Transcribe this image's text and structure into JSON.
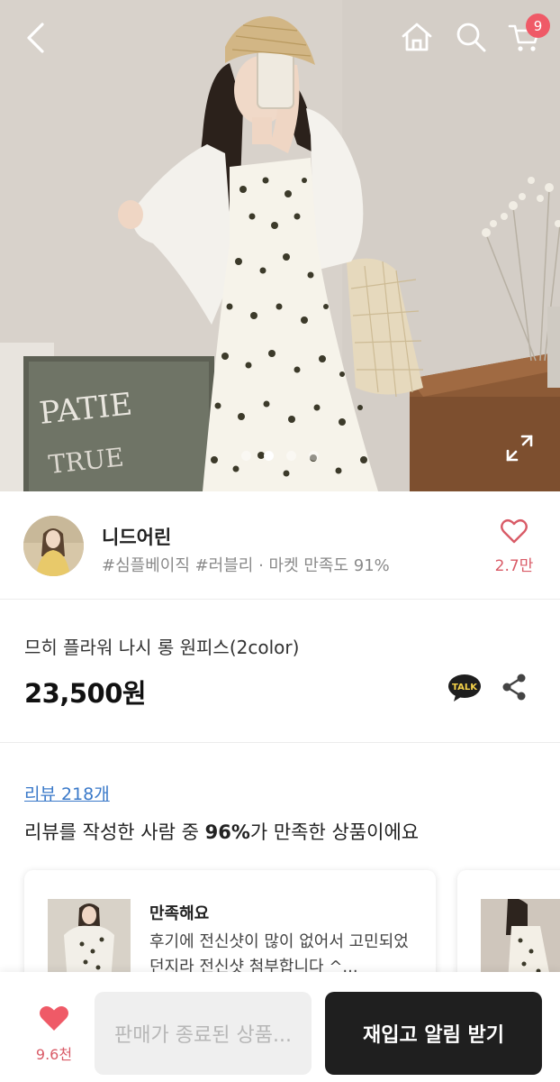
{
  "header": {
    "cart_count": "9"
  },
  "gallery": {
    "image_count": 4,
    "active_index": 1
  },
  "seller": {
    "name": "니드어린",
    "tags": "#심플베이직 #러블리 · 마켓 만족도 91%",
    "like_count": "2.7만"
  },
  "product": {
    "title": "므히 플라워 나시 롱 원피스(2color)",
    "price": "23,500원",
    "talk_label": "TALK"
  },
  "reviews": {
    "link": "리뷰 218개",
    "summary_prefix": "리뷰를 작성한 사람 중 ",
    "summary_highlight": "96%",
    "summary_suffix": "가 만족한 상품이에요",
    "items": [
      {
        "title": "만족해요",
        "text": "후기에 전신샷이 많이 없어서 고민되었던지라 전신샷  첨부합니다 ^..."
      }
    ]
  },
  "bottom_bar": {
    "wish_count": "9.6천",
    "soldout_label": "판매가 종료된 상품...",
    "notify_label": "재입고 알림 받기"
  },
  "colors": {
    "accent_pink": "#d95b67",
    "badge_red": "#ef5a67",
    "link_blue": "#3a79c9",
    "button_dark": "#1f1f1f"
  }
}
